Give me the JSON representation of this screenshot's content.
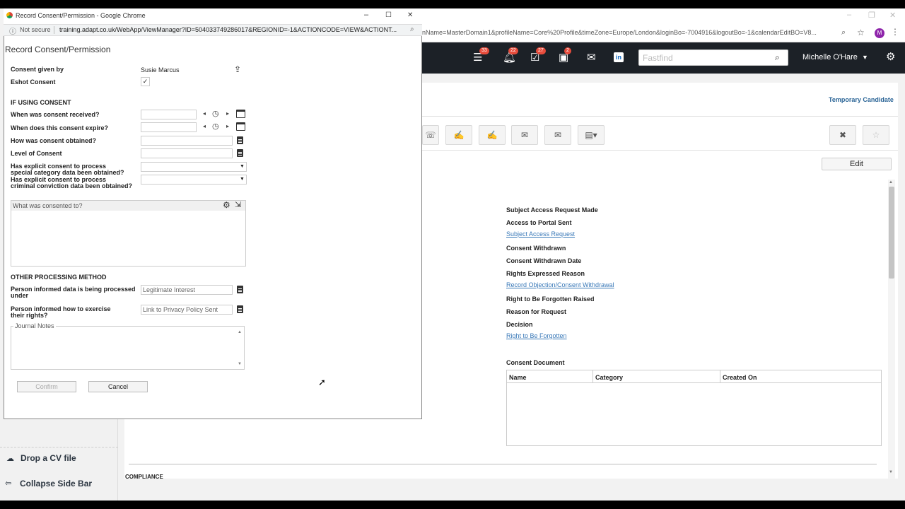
{
  "background": {
    "url": "nName=MasterDomain1&profileName=Core%20Profile&timeZone=Europe/London&loginBo=-7004916&logoutBo=-1&calendarEditBO=V8...",
    "badges": {
      "menu": "33",
      "bell": "22",
      "tasks": "27",
      "calendar": "2"
    },
    "fastfind_placeholder": "Fastfind",
    "user_name": "Michelle O'Hare",
    "avatar_initial": "M",
    "temporary_candidate": "Temporary Candidate",
    "edit_label": "Edit",
    "info": {
      "subject_access_request_made": "Subject Access Request Made",
      "access_to_portal_sent": "Access to Portal Sent",
      "subject_access_request_link": "Subject Access Request",
      "consent_withdrawn": "Consent Withdrawn",
      "consent_withdrawn_date": "Consent Withdrawn Date",
      "rights_expressed_reason": "Rights Expressed Reason",
      "record_objection_link": "Record Objection/Consent Withdrawal",
      "right_to_be_forgotten_raised": "Right to Be Forgotten Raised",
      "reason_for_request": "Reason for Request",
      "decision": "Decision",
      "right_to_be_forgotten_link": "Right to Be Forgotten",
      "consent_document": "Consent Document"
    },
    "table_headers": [
      "Name",
      "Category",
      "Created On"
    ],
    "compliance": "COMPLIANCE",
    "sidebar": {
      "drop_cv": "Drop a CV file",
      "collapse": "Collapse Side Bar"
    }
  },
  "popup": {
    "window_title": "Record Consent/Permission - Google Chrome",
    "not_secure": "Not secure",
    "url": "training.adapt.co.uk/WebApp/ViewManager?ID=504033749286017&REGIONID=-1&ACTIONCODE=VIEW&ACTIONT...",
    "form_title": "Record Consent/Permission",
    "consent_given_by_label": "Consent given by",
    "consent_given_by_value": "Susie Marcus",
    "eshot_consent_label": "Eshot Consent",
    "eshot_consent_checked": true,
    "if_using_consent": "IF USING CONSENT",
    "when_received_label": "When was consent received?",
    "when_expire_label": "When does this consent expire?",
    "how_obtained_label": "How was consent obtained?",
    "level_label": "Level of Consent",
    "special_category_label_1": "Has explicit consent to process",
    "special_category_label_2": "special category data been obtained?",
    "criminal_label_1": "Has explicit consent to process",
    "criminal_label_2": "criminal conviction data been obtained?",
    "what_consented_label": "What was consented to?",
    "other_processing": "OTHER PROCESSING METHOD",
    "informed_processed_label_1": "Person informed data is being processed",
    "informed_processed_label_2": "under",
    "informed_processed_value": "Legitimate Interest",
    "informed_rights_label_1": "Person informed how to exercise",
    "informed_rights_label_2": "their rights?",
    "informed_rights_value": "Link to Privacy Policy Sent",
    "journal_notes": "Journal Notes",
    "confirm": "Confirm",
    "cancel": "Cancel"
  }
}
